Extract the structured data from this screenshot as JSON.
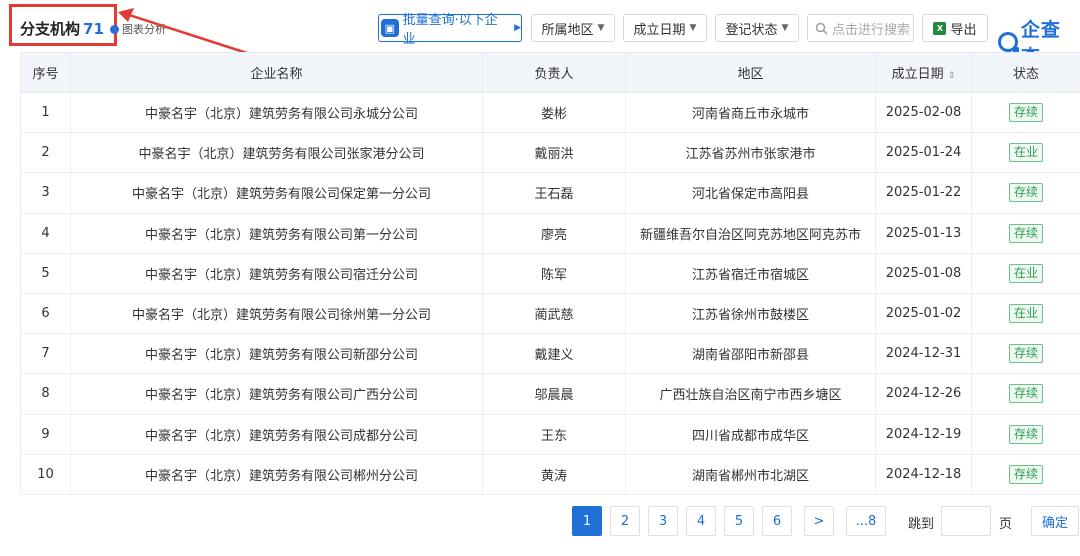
{
  "header": {
    "title": "分支机构",
    "count": "71",
    "chart_link": "图表分析"
  },
  "toolbar": {
    "bulk_query": "批量查询·以下企业",
    "region": "所属地区",
    "founded": "成立日期",
    "reg_status": "登记状态",
    "search_placeholder": "点击进行搜索",
    "export": "导出",
    "brand": "企查查"
  },
  "table": {
    "columns": [
      "序号",
      "企业名称",
      "负责人",
      "地区",
      "成立日期",
      "状态"
    ],
    "rows": [
      {
        "no": "1",
        "company": "中豪名宇（北京）建筑劳务有限公司永城分公司",
        "person": "娄彬",
        "region": "河南省商丘市永城市",
        "date": "2025-02-08",
        "status": "存续"
      },
      {
        "no": "2",
        "company": "中豪名宇（北京）建筑劳务有限公司张家港分公司",
        "person": "戴丽洪",
        "region": "江苏省苏州市张家港市",
        "date": "2025-01-24",
        "status": "在业"
      },
      {
        "no": "3",
        "company": "中豪名宇（北京）建筑劳务有限公司保定第一分公司",
        "person": "王石磊",
        "region": "河北省保定市高阳县",
        "date": "2025-01-22",
        "status": "存续"
      },
      {
        "no": "4",
        "company": "中豪名宇（北京）建筑劳务有限公司第一分公司",
        "person": "廖亮",
        "region": "新疆维吾尔自治区阿克苏地区阿克苏市",
        "date": "2025-01-13",
        "status": "存续"
      },
      {
        "no": "5",
        "company": "中豪名宇（北京）建筑劳务有限公司宿迁分公司",
        "person": "陈军",
        "region": "江苏省宿迁市宿城区",
        "date": "2025-01-08",
        "status": "在业"
      },
      {
        "no": "6",
        "company": "中豪名宇（北京）建筑劳务有限公司徐州第一分公司",
        "person": "蔺武慈",
        "region": "江苏省徐州市鼓楼区",
        "date": "2025-01-02",
        "status": "在业"
      },
      {
        "no": "7",
        "company": "中豪名宇（北京）建筑劳务有限公司新邵分公司",
        "person": "戴建义",
        "region": "湖南省邵阳市新邵县",
        "date": "2024-12-31",
        "status": "存续"
      },
      {
        "no": "8",
        "company": "中豪名宇（北京）建筑劳务有限公司广西分公司",
        "person": "邬晨晨",
        "region": "广西壮族自治区南宁市西乡塘区",
        "date": "2024-12-26",
        "status": "存续"
      },
      {
        "no": "9",
        "company": "中豪名宇（北京）建筑劳务有限公司成都分公司",
        "person": "王东",
        "region": "四川省成都市成华区",
        "date": "2024-12-19",
        "status": "存续"
      },
      {
        "no": "10",
        "company": "中豪名宇（北京）建筑劳务有限公司郴州分公司",
        "person": "黄涛",
        "region": "湖南省郴州市北湖区",
        "date": "2024-12-18",
        "status": "存续"
      }
    ]
  },
  "pagination": {
    "pages": [
      "1",
      "2",
      "3",
      "4",
      "5",
      "6"
    ],
    "current": "1",
    "next": ">",
    "last": "...8",
    "jump_label": "跳到",
    "page_unit": "页",
    "confirm": "确定"
  },
  "colors": {
    "accent": "#1f6fd6",
    "highlight_border": "#e23b35",
    "status_green": "#2e9b55"
  }
}
